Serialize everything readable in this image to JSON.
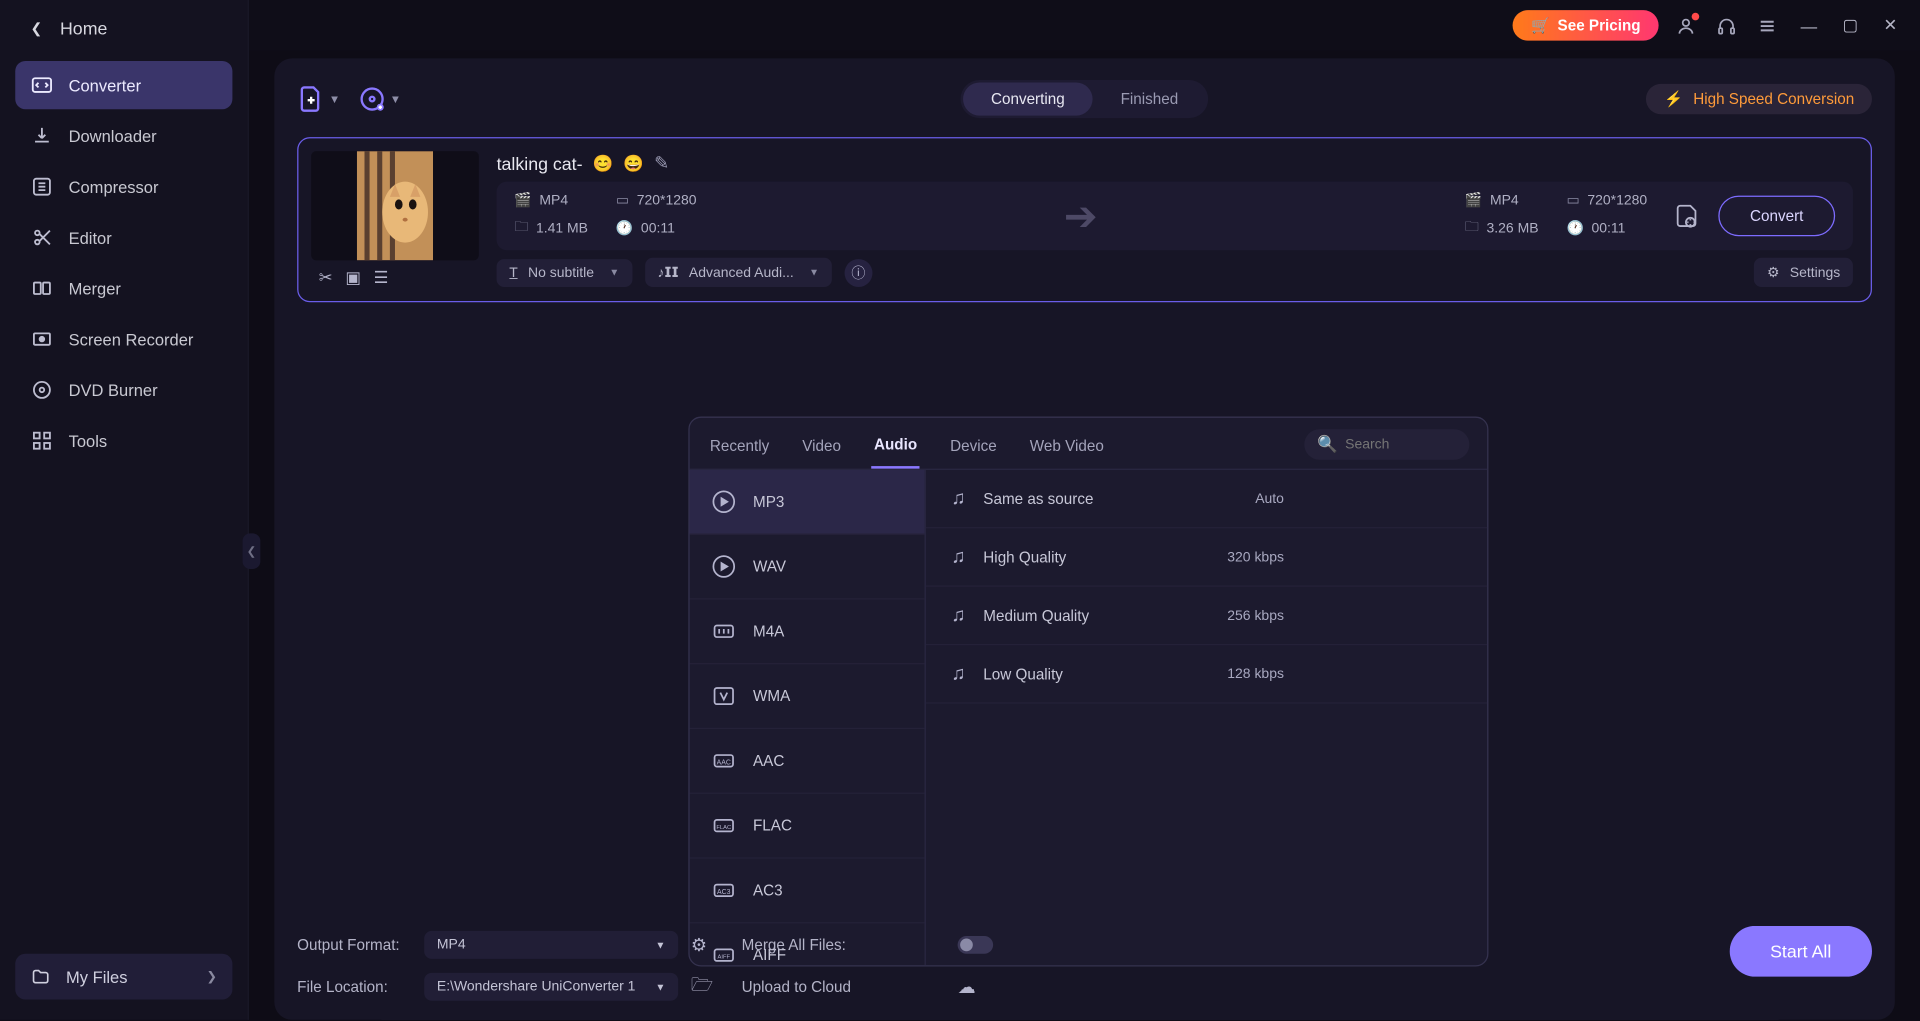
{
  "titlebar": {
    "pricing": "See Pricing"
  },
  "sidebar": {
    "home": "Home",
    "items": [
      {
        "label": "Converter"
      },
      {
        "label": "Downloader"
      },
      {
        "label": "Compressor"
      },
      {
        "label": "Editor"
      },
      {
        "label": "Merger"
      },
      {
        "label": "Screen Recorder"
      },
      {
        "label": "DVD Burner"
      },
      {
        "label": "Tools"
      }
    ],
    "myfiles": "My Files"
  },
  "toprow": {
    "tabs": {
      "converting": "Converting",
      "finished": "Finished"
    },
    "hsc": "High Speed Conversion"
  },
  "file": {
    "name": "talking cat-",
    "src": {
      "format": "MP4",
      "res": "720*1280",
      "size": "1.41 MB",
      "dur": "00:11"
    },
    "dst": {
      "format": "MP4",
      "res": "720*1280",
      "size": "3.26 MB",
      "dur": "00:11"
    },
    "subtitle": "No subtitle",
    "audio": "Advanced Audi...",
    "settings": "Settings",
    "convert": "Convert"
  },
  "dropdown": {
    "tabs": [
      "Recently",
      "Video",
      "Audio",
      "Device",
      "Web Video"
    ],
    "search_placeholder": "Search",
    "formats": [
      "MP3",
      "WAV",
      "M4A",
      "WMA",
      "AAC",
      "FLAC",
      "AC3",
      "AIFF"
    ],
    "qualities": [
      {
        "label": "Same as source",
        "rate": "Auto"
      },
      {
        "label": "High Quality",
        "rate": "320 kbps"
      },
      {
        "label": "Medium Quality",
        "rate": "256 kbps"
      },
      {
        "label": "Low Quality",
        "rate": "128 kbps"
      }
    ]
  },
  "footer": {
    "output_label": "Output Format:",
    "output_value": "MP4",
    "location_label": "File Location:",
    "location_value": "E:\\Wondershare UniConverter 1",
    "merge": "Merge All Files:",
    "upload": "Upload to Cloud",
    "start": "Start All"
  }
}
